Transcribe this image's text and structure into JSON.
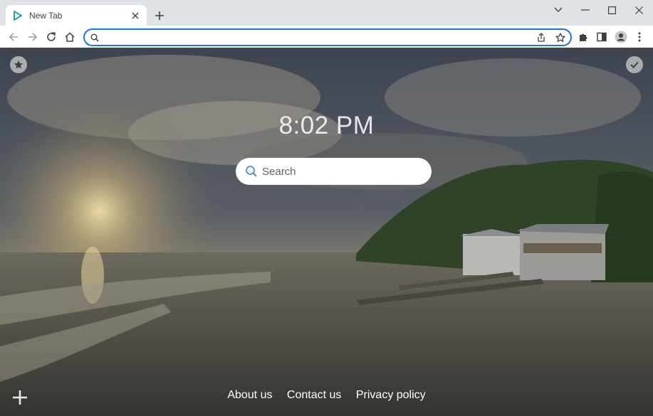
{
  "browser": {
    "tab": {
      "title": "New Tab"
    },
    "omnibox": {
      "value": "",
      "placeholder": ""
    }
  },
  "newtab": {
    "clock": "8:02 PM",
    "search": {
      "placeholder": "Search"
    },
    "links": [
      "About us",
      "Contact us",
      "Privacy policy"
    ]
  },
  "colors": {
    "accent": "#1a73e8",
    "chrome_frame": "#dee1e6"
  },
  "icons": {
    "tab_favicon": "play-triangle-icon",
    "top_left": "star-icon",
    "top_right": "check-icon",
    "bottom_left": "plus-icon"
  }
}
